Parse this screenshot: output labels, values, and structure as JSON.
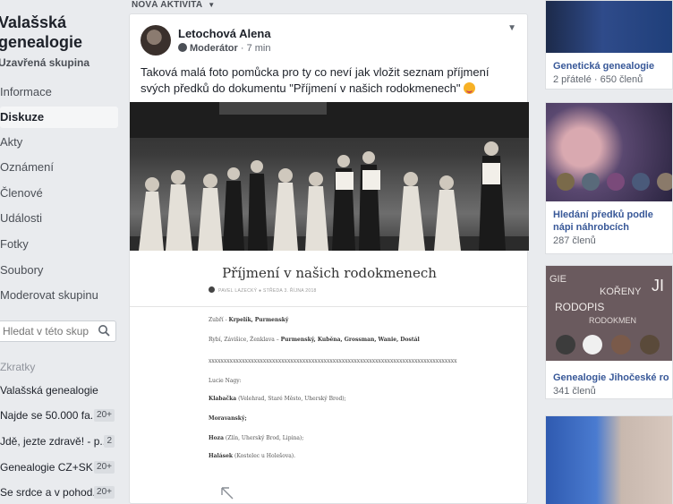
{
  "sidebar": {
    "group_name": "Valašská genealogie",
    "group_type": "Uzavřená skupina",
    "nav": [
      "Informace",
      "Diskuze",
      "Akty",
      "Oznámení",
      "Členové",
      "Události",
      "Fotky",
      "Soubory",
      "Moderovat skupinu"
    ],
    "active_index": 1,
    "search_placeholder": "Hledat v této skupině",
    "shortcuts_title": "Zkratky",
    "shortcuts": [
      {
        "label": "Valašská genealogie",
        "badge": ""
      },
      {
        "label": "Najde se 50.000 fa...",
        "badge": "20+"
      },
      {
        "label": "Jdě, jezte zdravě! - p...",
        "badge": "2"
      },
      {
        "label": "Genealogie CZ+SK",
        "badge": "20+"
      },
      {
        "label": "Se srdce a v pohod...",
        "badge": "20+"
      }
    ]
  },
  "feed": {
    "header": "NOVÁ AKTIVITA"
  },
  "post": {
    "author": "Letochová Alena",
    "role": "Moderátor",
    "time": "7 min",
    "text": "Taková malá foto pomůcka pro ty co neví jak vložit seznam příjmení svých předků do dokumentu \"Příjmení v našich rodokmenech\"",
    "doc": {
      "title": "Příjmení v našich rodokmenech",
      "author_line": "PAVEL LAZECKÝ ● STŘEDA 3. ŘÍJNA 2018",
      "lines": [
        {
          "plain": "Zubří - ",
          "bold": "Krpelík, Purmenský"
        },
        {
          "plain": "Rybí, Závišice, Ženklava – ",
          "bold": "Purmenský, Kuběna, Grossman, Wanie, Dostál"
        },
        {
          "plain": "xxxxxxxxxxxxxxxxxxxxxxxxxxxxxxxxxxxxxxxxxxxxxxxxxxxxxxxxxxxxxxxxxxxxxxxxxxxxxxxxxx",
          "bold": ""
        },
        {
          "plain": "Lucie Nagy:",
          "bold": ""
        },
        {
          "plain": " (Velehrad, Staré Město, Uherský Brod);",
          "bold": "Klabačka"
        },
        {
          "plain": "",
          "bold": "Moravanský;"
        },
        {
          "plain": " (Zlín, Uherský Brod, Lipina);",
          "bold": "Hoza"
        },
        {
          "plain": " (Kostelec u Holešova).",
          "bold": "Halásek"
        }
      ]
    }
  },
  "right": {
    "cards": [
      {
        "title": "Genetická genealogie",
        "count": "2 přátelé · 650 členů"
      },
      {
        "title": "Hledání předků podle nápi náhrobcích",
        "count": "287 členů"
      },
      {
        "title": "Genealogie Jihočeské ro",
        "count": "341 členů"
      }
    ],
    "image_words": [
      "GIE",
      "KOŘENY",
      "RODOPIS",
      "RODOKMEN",
      "JI"
    ]
  }
}
